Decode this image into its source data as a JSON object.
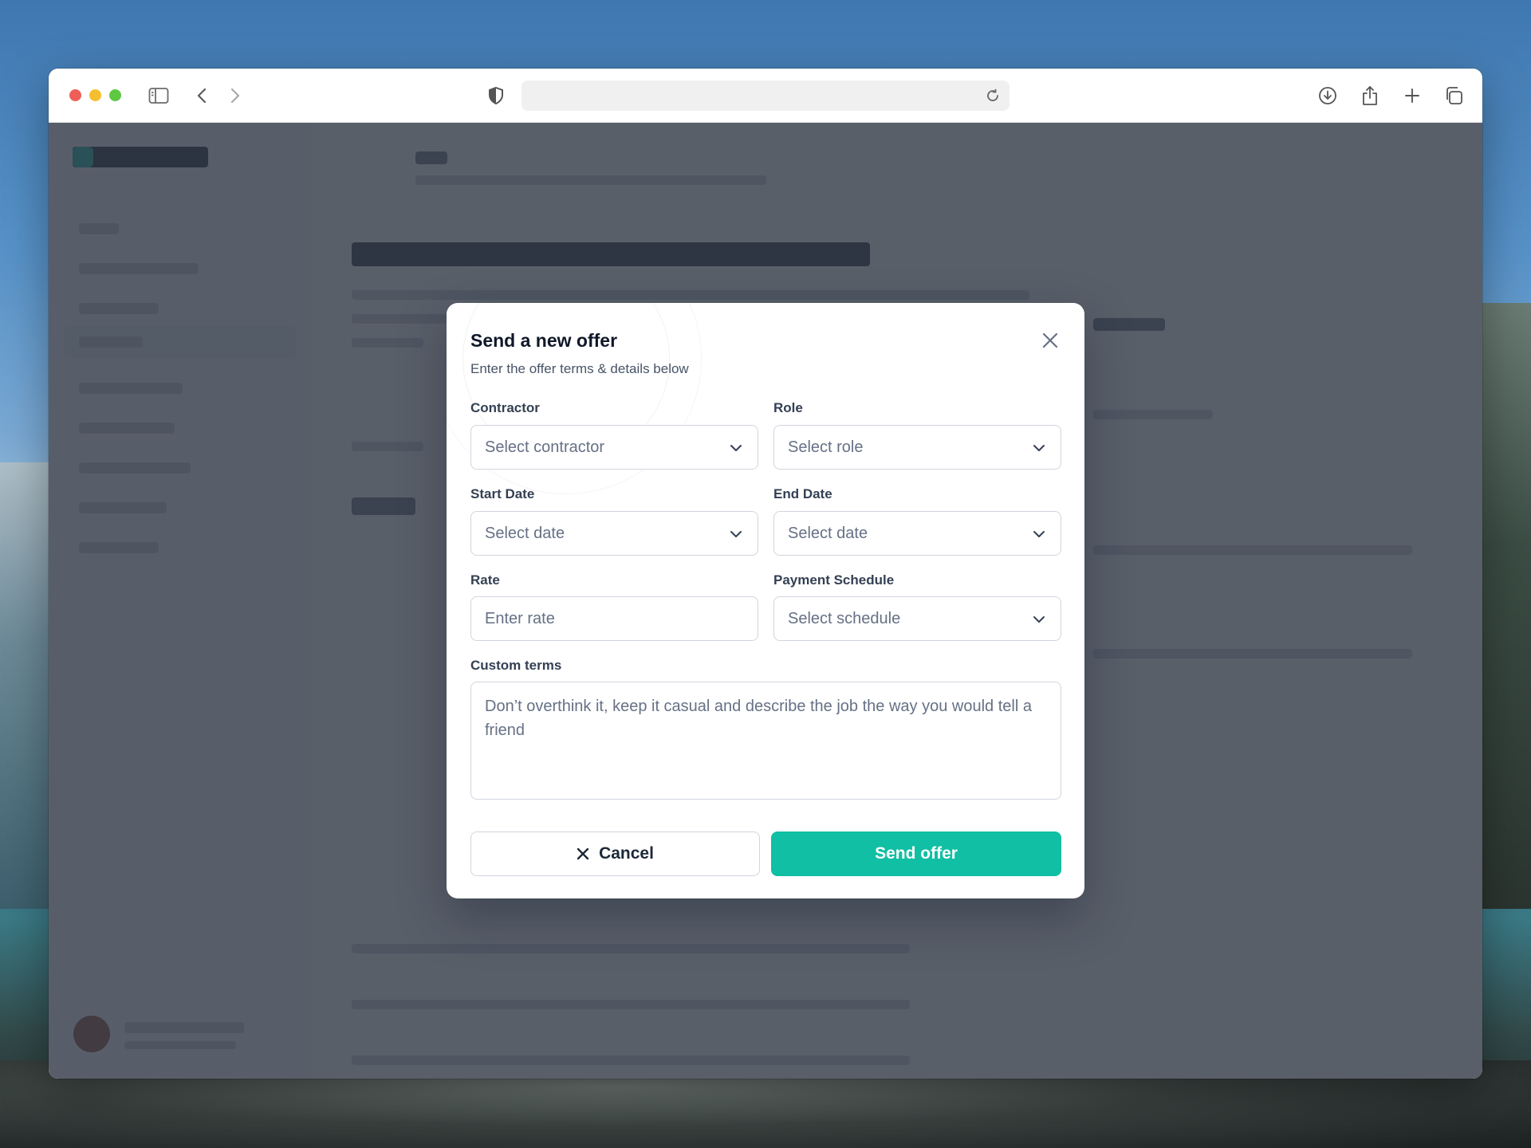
{
  "browser": {
    "address_text": ""
  },
  "modal": {
    "title": "Send a new offer",
    "subtitle": "Enter the offer terms & details below",
    "fields": {
      "contractor": {
        "label": "Contractor",
        "placeholder": "Select contractor"
      },
      "role": {
        "label": "Role",
        "placeholder": "Select role"
      },
      "start_date": {
        "label": "Start Date",
        "placeholder": "Select date"
      },
      "end_date": {
        "label": "End Date",
        "placeholder": "Select date"
      },
      "rate": {
        "label": "Rate",
        "placeholder": "Enter rate"
      },
      "payment_schedule": {
        "label": "Payment Schedule",
        "placeholder": "Select schedule"
      },
      "custom_terms": {
        "label": "Custom terms",
        "placeholder": "Don’t overthink it, keep it casual and describe the job the way you would tell a friend"
      }
    },
    "buttons": {
      "cancel": "Cancel",
      "send": "Send offer"
    }
  },
  "colors": {
    "primary": "#10bfa4",
    "overlay": "#2f3744"
  },
  "icons": {
    "close": "close-icon",
    "chevron": "chevron-down-icon",
    "cancel": "x-icon"
  }
}
